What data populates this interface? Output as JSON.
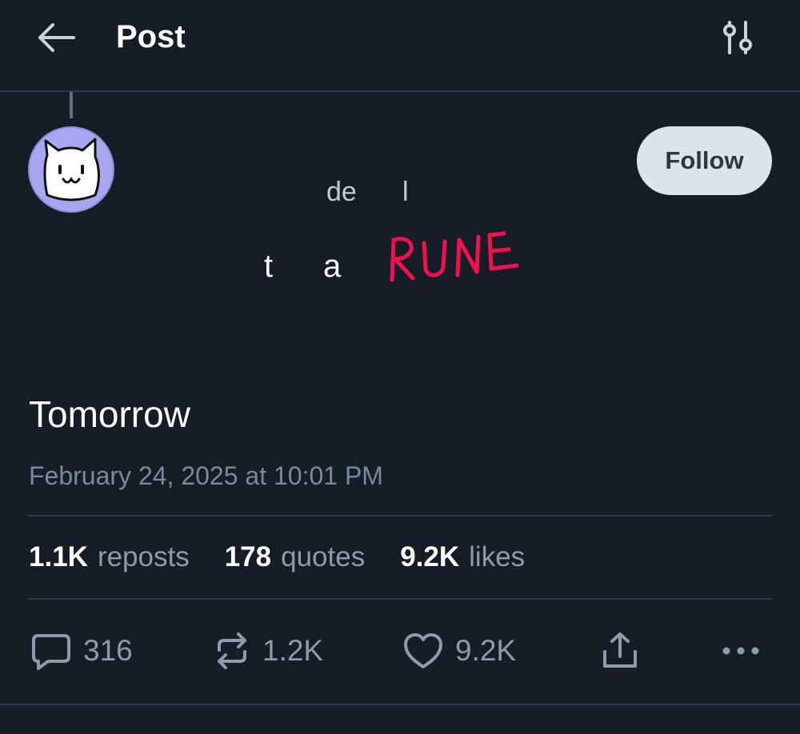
{
  "header": {
    "title": "Post",
    "back_icon": "arrow-left-icon",
    "settings_icon": "sliders-icon"
  },
  "author": {
    "avatar_icon": "cat-face-icon",
    "avatar_bg": "#a8a6f0",
    "name_fragments": [
      "de",
      "l"
    ],
    "handle_fragments": [
      "t",
      "a"
    ],
    "rune_text": "RUNE",
    "rune_color": "#f0124e"
  },
  "follow_button": {
    "label": "Follow"
  },
  "post": {
    "text": "Tomorrow",
    "timestamp": "February 24, 2025 at 10:01 PM"
  },
  "stats": {
    "reposts": {
      "count": "1.1K",
      "label": "reposts"
    },
    "quotes": {
      "count": "178",
      "label": "quotes"
    },
    "likes": {
      "count": "9.2K",
      "label": "likes"
    }
  },
  "actions": {
    "reply": {
      "icon": "speech-bubble-icon",
      "count": "316"
    },
    "repost": {
      "icon": "repost-icon",
      "count": "1.2K"
    },
    "like": {
      "icon": "heart-icon",
      "count": "9.2K"
    },
    "share": {
      "icon": "share-icon"
    },
    "more": {
      "icon": "more-dots-icon"
    }
  },
  "colors": {
    "background": "#161d26",
    "divider": "#2e3a48",
    "muted_text": "#8e9bab",
    "follow_bg": "#dce3ea"
  }
}
